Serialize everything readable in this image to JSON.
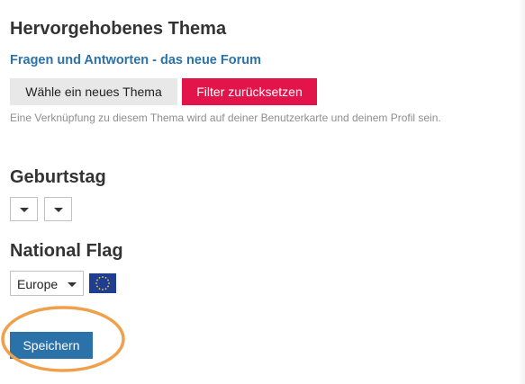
{
  "featured_topic": {
    "title": "Hervorgehobenes Thema",
    "topic_link": "Fragen und Antworten - das neue Forum",
    "choose_button": "Wähle ein neues Thema",
    "reset_button": "Filter zurücksetzen",
    "help_text": "Eine Verknüpfung zu diesem Thema wird auf deiner Benutzerkarte und deinem Profil sein."
  },
  "birthday": {
    "title": "Geburtstag"
  },
  "national_flag": {
    "title": "National Flag",
    "selected": "Europe",
    "flag_icon": "eu-flag-icon"
  },
  "save_button": "Speichern",
  "colors": {
    "link": "#2a72a8",
    "reset_button": "#e2144a",
    "save_button": "#2a72a8",
    "highlight_ring": "#f0a04b",
    "eu_flag_blue": "#1f3e91",
    "eu_flag_stars": "#f5d33a"
  }
}
